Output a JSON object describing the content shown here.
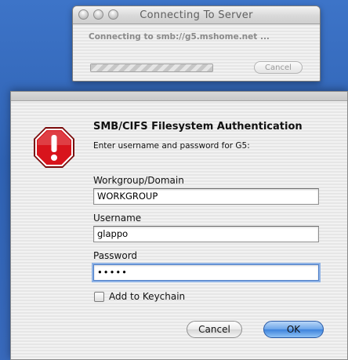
{
  "connect_window": {
    "title": "Connecting To Server",
    "status_text": "Connecting to smb://g5.mshome.net ...",
    "cancel_label": "Cancel",
    "progress": "indeterminate"
  },
  "auth_dialog": {
    "heading": "SMB/CIFS Filesystem Authentication",
    "subtext": "Enter username and password for G5:",
    "icon": "stop-alert-icon",
    "workgroup": {
      "label": "Workgroup/Domain",
      "value": "WORKGROUP"
    },
    "username": {
      "label": "Username",
      "value": "glappo"
    },
    "password": {
      "label": "Password",
      "value": "•••••"
    },
    "keychain": {
      "label": "Add to Keychain",
      "checked": false
    },
    "cancel_label": "Cancel",
    "ok_label": "OK"
  },
  "colors": {
    "desktop": "#3466b8",
    "stop_red": "#d8141c",
    "default_button": "#4a8be0"
  }
}
